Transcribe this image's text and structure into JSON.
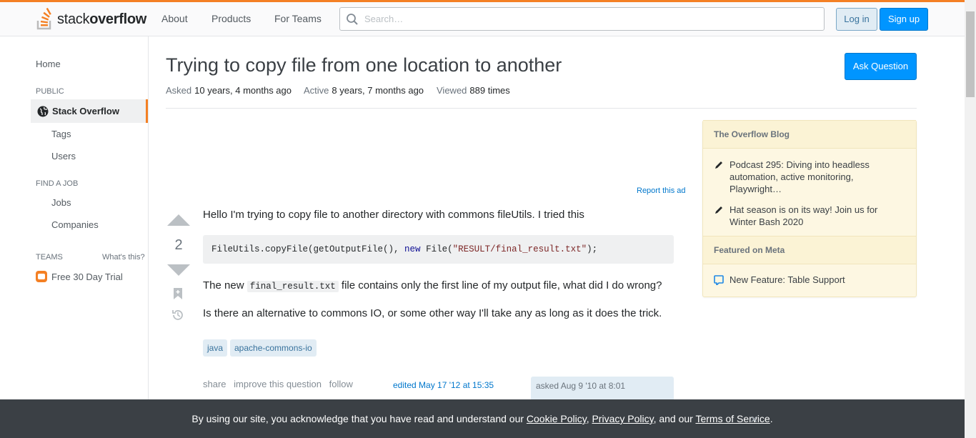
{
  "header": {
    "logo": {
      "text_plain": "stack",
      "text_bold": "overflow"
    },
    "nav": [
      "About",
      "Products",
      "For Teams"
    ],
    "search_placeholder": "Search…",
    "login_label": "Log in",
    "signup_label": "Sign up"
  },
  "sidebar": {
    "home": "Home",
    "public_label": "PUBLIC",
    "active_item": "Stack Overflow",
    "public_items": [
      "Tags",
      "Users"
    ],
    "find_job_label": "FIND A JOB",
    "job_items": [
      "Jobs",
      "Companies"
    ],
    "teams_label": "TEAMS",
    "whats_this": "What's this?",
    "trial_label": "Free 30 Day Trial"
  },
  "question": {
    "title": "Trying to copy file from one location to another",
    "asked_label": "Asked",
    "asked_value": "10 years, 4 months ago",
    "active_label": "Active",
    "active_value": "8 years, 7 months ago",
    "viewed_label": "Viewed",
    "viewed_value": "889 times",
    "ask_button": "Ask Question",
    "report_ad": "Report this ad",
    "votes": "2",
    "body_intro": "Hello I'm trying to copy file to another directory with commons fileUtils. I tried this",
    "code": {
      "part1": "FileUtils.copyFile(getOutputFile(), ",
      "keyword": "new",
      "part2": " File(",
      "string": "\"RESULT/final_result.txt\"",
      "part3": ");"
    },
    "body_p2_before": "The new ",
    "body_p2_code": "final_result.txt",
    "body_p2_after": " file contains only the first line of my output file, what did I do wrong?",
    "body_p3": "Is there an alternative to commons IO, or some other way I'll take any as long as it does the trick.",
    "tags": [
      "java",
      "apache-commons-io"
    ],
    "menu": [
      "share",
      "improve this question",
      "follow"
    ],
    "edited": "edited May 17 '12 at 15:35",
    "asked_card": "asked Aug 9 '10 at 8:01"
  },
  "blog": {
    "section1": "The Overflow Blog",
    "items1": [
      "Podcast 295: Diving into headless automation, active monitoring, Playwright…",
      "Hat season is on its way! Join us for Winter Bash 2020"
    ],
    "section2": "Featured on Meta",
    "items2": [
      "New Feature: Table Support"
    ]
  },
  "cookie": {
    "text_before": "By using our site, you acknowledge that you have read and understand our ",
    "cookie_policy": "Cookie Policy",
    "comma": ", ",
    "privacy_policy": "Privacy Policy",
    "and_our": ", and our ",
    "terms": "Terms of Service",
    "period": ".",
    "close": "×"
  },
  "colors": {
    "accent": "#f48024",
    "primary": "#0095ff",
    "tag_bg": "#e1ecf4",
    "blog_bg": "#fdf7e2"
  }
}
